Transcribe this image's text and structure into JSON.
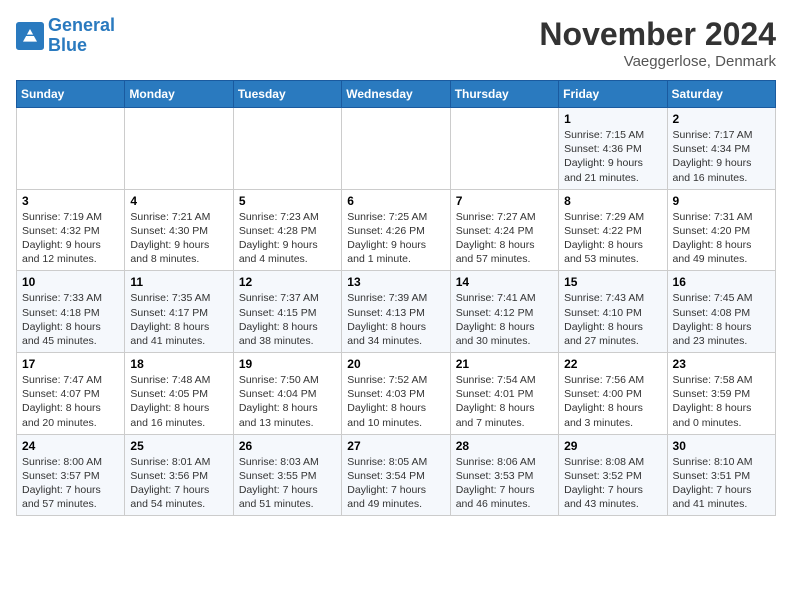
{
  "header": {
    "logo_line1": "General",
    "logo_line2": "Blue",
    "month": "November 2024",
    "location": "Vaeggerlose, Denmark"
  },
  "days_of_week": [
    "Sunday",
    "Monday",
    "Tuesday",
    "Wednesday",
    "Thursday",
    "Friday",
    "Saturday"
  ],
  "weeks": [
    [
      {
        "day": "",
        "info": ""
      },
      {
        "day": "",
        "info": ""
      },
      {
        "day": "",
        "info": ""
      },
      {
        "day": "",
        "info": ""
      },
      {
        "day": "",
        "info": ""
      },
      {
        "day": "1",
        "info": "Sunrise: 7:15 AM\nSunset: 4:36 PM\nDaylight: 9 hours and 21 minutes."
      },
      {
        "day": "2",
        "info": "Sunrise: 7:17 AM\nSunset: 4:34 PM\nDaylight: 9 hours and 16 minutes."
      }
    ],
    [
      {
        "day": "3",
        "info": "Sunrise: 7:19 AM\nSunset: 4:32 PM\nDaylight: 9 hours and 12 minutes."
      },
      {
        "day": "4",
        "info": "Sunrise: 7:21 AM\nSunset: 4:30 PM\nDaylight: 9 hours and 8 minutes."
      },
      {
        "day": "5",
        "info": "Sunrise: 7:23 AM\nSunset: 4:28 PM\nDaylight: 9 hours and 4 minutes."
      },
      {
        "day": "6",
        "info": "Sunrise: 7:25 AM\nSunset: 4:26 PM\nDaylight: 9 hours and 1 minute."
      },
      {
        "day": "7",
        "info": "Sunrise: 7:27 AM\nSunset: 4:24 PM\nDaylight: 8 hours and 57 minutes."
      },
      {
        "day": "8",
        "info": "Sunrise: 7:29 AM\nSunset: 4:22 PM\nDaylight: 8 hours and 53 minutes."
      },
      {
        "day": "9",
        "info": "Sunrise: 7:31 AM\nSunset: 4:20 PM\nDaylight: 8 hours and 49 minutes."
      }
    ],
    [
      {
        "day": "10",
        "info": "Sunrise: 7:33 AM\nSunset: 4:18 PM\nDaylight: 8 hours and 45 minutes."
      },
      {
        "day": "11",
        "info": "Sunrise: 7:35 AM\nSunset: 4:17 PM\nDaylight: 8 hours and 41 minutes."
      },
      {
        "day": "12",
        "info": "Sunrise: 7:37 AM\nSunset: 4:15 PM\nDaylight: 8 hours and 38 minutes."
      },
      {
        "day": "13",
        "info": "Sunrise: 7:39 AM\nSunset: 4:13 PM\nDaylight: 8 hours and 34 minutes."
      },
      {
        "day": "14",
        "info": "Sunrise: 7:41 AM\nSunset: 4:12 PM\nDaylight: 8 hours and 30 minutes."
      },
      {
        "day": "15",
        "info": "Sunrise: 7:43 AM\nSunset: 4:10 PM\nDaylight: 8 hours and 27 minutes."
      },
      {
        "day": "16",
        "info": "Sunrise: 7:45 AM\nSunset: 4:08 PM\nDaylight: 8 hours and 23 minutes."
      }
    ],
    [
      {
        "day": "17",
        "info": "Sunrise: 7:47 AM\nSunset: 4:07 PM\nDaylight: 8 hours and 20 minutes."
      },
      {
        "day": "18",
        "info": "Sunrise: 7:48 AM\nSunset: 4:05 PM\nDaylight: 8 hours and 16 minutes."
      },
      {
        "day": "19",
        "info": "Sunrise: 7:50 AM\nSunset: 4:04 PM\nDaylight: 8 hours and 13 minutes."
      },
      {
        "day": "20",
        "info": "Sunrise: 7:52 AM\nSunset: 4:03 PM\nDaylight: 8 hours and 10 minutes."
      },
      {
        "day": "21",
        "info": "Sunrise: 7:54 AM\nSunset: 4:01 PM\nDaylight: 8 hours and 7 minutes."
      },
      {
        "day": "22",
        "info": "Sunrise: 7:56 AM\nSunset: 4:00 PM\nDaylight: 8 hours and 3 minutes."
      },
      {
        "day": "23",
        "info": "Sunrise: 7:58 AM\nSunset: 3:59 PM\nDaylight: 8 hours and 0 minutes."
      }
    ],
    [
      {
        "day": "24",
        "info": "Sunrise: 8:00 AM\nSunset: 3:57 PM\nDaylight: 7 hours and 57 minutes."
      },
      {
        "day": "25",
        "info": "Sunrise: 8:01 AM\nSunset: 3:56 PM\nDaylight: 7 hours and 54 minutes."
      },
      {
        "day": "26",
        "info": "Sunrise: 8:03 AM\nSunset: 3:55 PM\nDaylight: 7 hours and 51 minutes."
      },
      {
        "day": "27",
        "info": "Sunrise: 8:05 AM\nSunset: 3:54 PM\nDaylight: 7 hours and 49 minutes."
      },
      {
        "day": "28",
        "info": "Sunrise: 8:06 AM\nSunset: 3:53 PM\nDaylight: 7 hours and 46 minutes."
      },
      {
        "day": "29",
        "info": "Sunrise: 8:08 AM\nSunset: 3:52 PM\nDaylight: 7 hours and 43 minutes."
      },
      {
        "day": "30",
        "info": "Sunrise: 8:10 AM\nSunset: 3:51 PM\nDaylight: 7 hours and 41 minutes."
      }
    ]
  ]
}
